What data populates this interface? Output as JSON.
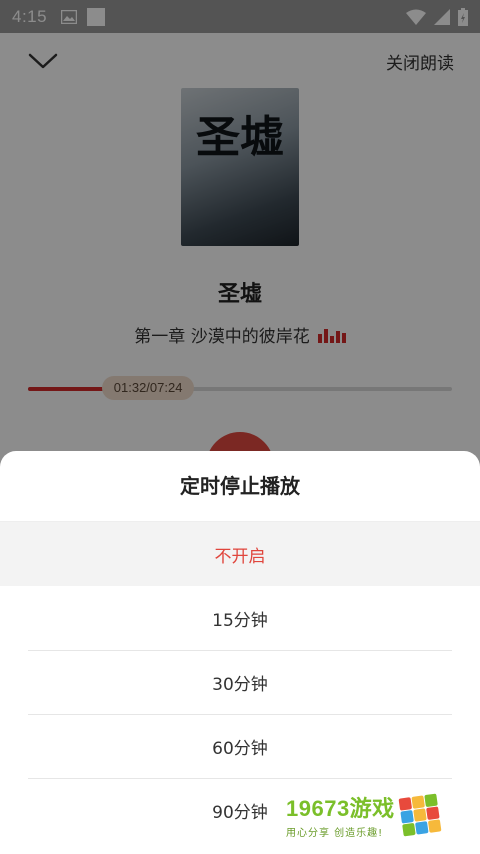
{
  "status_bar": {
    "time": "4:15"
  },
  "header": {
    "close_label": "关闭朗读"
  },
  "book": {
    "cover_glyph": "圣墟",
    "title": "圣墟",
    "chapter": "第一章 沙漠中的彼岸花"
  },
  "playback": {
    "position_label": "01:32/07:24",
    "progress": 0.207,
    "accent_color": "#d42a2a"
  },
  "timer_sheet": {
    "title": "定时停止播放",
    "options": [
      "不开启",
      "15分钟",
      "30分钟",
      "60分钟",
      "90分钟"
    ],
    "selected": "不开启",
    "selected_color": "#e0453c"
  },
  "watermark": {
    "brand": "19673游戏",
    "tagline": "用心分享 创造乐趣!"
  }
}
